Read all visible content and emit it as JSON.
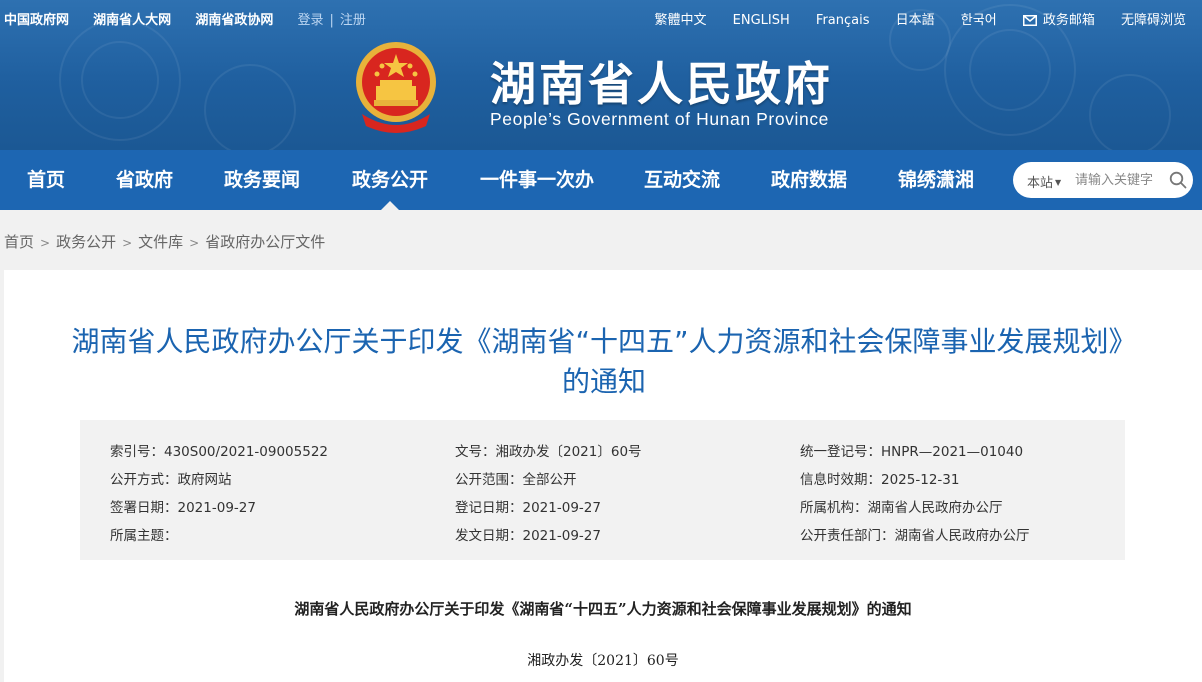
{
  "topbar": {
    "links": [
      "中国政府网",
      "湖南省人大网",
      "湖南省政协网"
    ],
    "login": "登录",
    "separator": "|",
    "register": "注册",
    "languages": [
      "繁體中文",
      "ENGLISH",
      "Français",
      "日本語",
      "한국어"
    ],
    "mail": "政务邮箱",
    "accessibility": "无障碍浏览"
  },
  "header": {
    "title_cn": "湖南省人民政府",
    "title_en": "People’s Government of Hunan Province"
  },
  "nav": {
    "items": [
      "首页",
      "省政府",
      "政务要闻",
      "政务公开",
      "一件事一次办",
      "互动交流",
      "政府数据",
      "锦绣潇湘"
    ],
    "active": "政务公开"
  },
  "search": {
    "scope": "本站",
    "placeholder": "请输入关键字"
  },
  "breadcrumb": [
    "首页",
    "政务公开",
    "文件库",
    "省政府办公厅文件"
  ],
  "document": {
    "title": "湖南省人民政府办公厅关于印发《湖南省“十四五”人力资源和社会保障事业发展规划》的通知",
    "meta": {
      "index_no": "索引号：430S00/2021-09005522",
      "doc_no": "文号：湘政办发〔2021〕60号",
      "unified_reg_no": "统一登记号：HNPR—2021—01040",
      "publish_method": "公开方式：政府网站",
      "publish_scope": "公开范围：全部公开",
      "valid_until": "信息时效期：2025-12-31",
      "sign_date": "签署日期：2021-09-27",
      "register_date": "登记日期：2021-09-27",
      "agency": "所属机构：湖南省人民政府办公厅",
      "topic": "所属主题：",
      "issue_date": "发文日期：2021-09-27",
      "responsible_dept": "公开责任部门：湖南省人民政府办公厅"
    },
    "heading": "湖南省人民政府办公厅关于印发《湖南省“十四五”人力资源和社会保障事业发展规划》的通知",
    "number": "湘政办发〔2021〕60号"
  },
  "colors": {
    "banner": "#2567a8",
    "nav": "#1d66b2",
    "title": "#1b64b0",
    "background": "#f1f1f1"
  }
}
